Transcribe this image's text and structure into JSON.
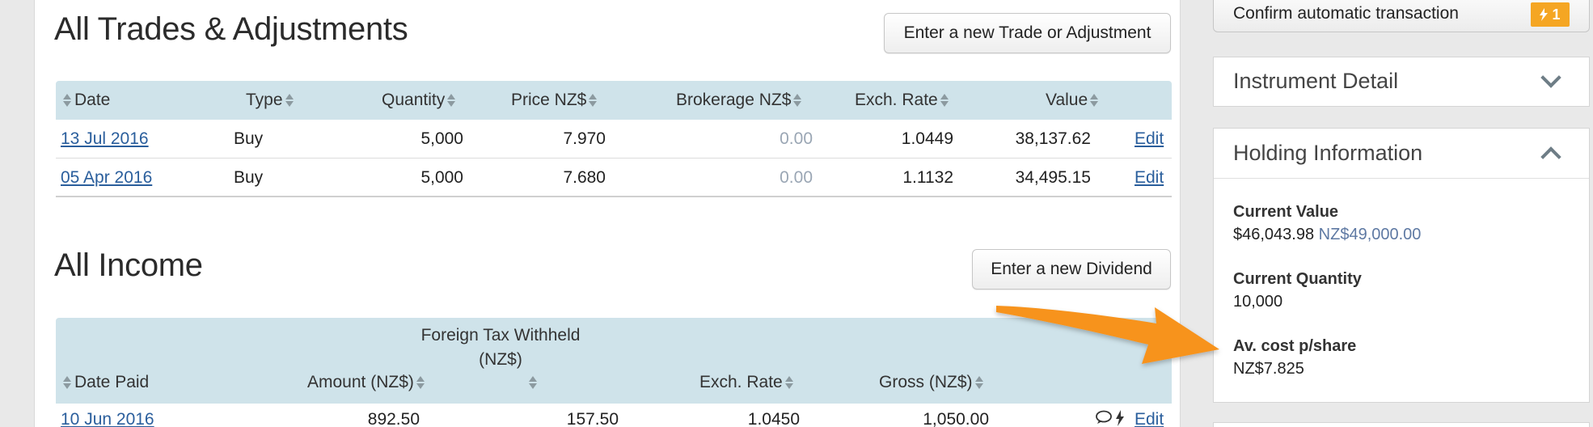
{
  "trades": {
    "title": "All Trades & Adjustments",
    "new_button": "Enter a new Trade or Adjustment",
    "columns": [
      "Date",
      "Type",
      "Quantity",
      "Price NZ$",
      "Brokerage NZ$",
      "Exch. Rate",
      "Value"
    ],
    "rows": [
      {
        "date": "13 Jul 2016",
        "type": "Buy",
        "quantity": "5,000",
        "price": "7.970",
        "brokerage": "0.00",
        "exch_rate": "1.0449",
        "value": "38,137.62",
        "edit": "Edit"
      },
      {
        "date": "05 Apr 2016",
        "type": "Buy",
        "quantity": "5,000",
        "price": "7.680",
        "brokerage": "0.00",
        "exch_rate": "1.1132",
        "value": "34,495.15",
        "edit": "Edit"
      }
    ]
  },
  "income": {
    "title": "All Income",
    "new_button": "Enter a new Dividend",
    "columns": {
      "date_paid": "Date Paid",
      "amount": "Amount (NZ$)",
      "foreign_tax_line1": "Foreign Tax Withheld",
      "foreign_tax_line2": "(NZ$)",
      "exch_rate": "Exch. Rate",
      "gross": "Gross (NZ$)"
    },
    "rows": [
      {
        "date_paid": "10 Jun 2016",
        "amount": "892.50",
        "foreign_tax": "157.50",
        "exch_rate": "1.0450",
        "gross": "1,050.00",
        "edit": "Edit"
      }
    ]
  },
  "sidebar": {
    "confirm_label": "Confirm automatic transaction",
    "confirm_badge": "1",
    "instrument_detail": "Instrument Detail",
    "holding_information": "Holding Information",
    "current_value_label": "Current Value",
    "current_value": "$46,043.98",
    "current_value_alt": "NZ$49,000.00",
    "current_quantity_label": "Current Quantity",
    "current_quantity": "10,000",
    "avg_cost_label": "Av. cost p/share",
    "avg_cost": "NZ$7.825"
  },
  "colors": {
    "table_header": "#cfe3ea",
    "link": "#2a5e9c",
    "badge": "#f5a623",
    "arrow": "#f7931e"
  }
}
